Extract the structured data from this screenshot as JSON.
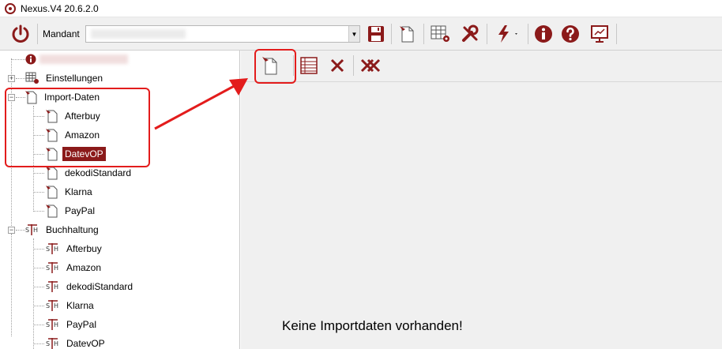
{
  "window": {
    "title": "Nexus.V4 20.6.2.0"
  },
  "toolbar": {
    "mandant_label": "Mandant",
    "icons": [
      "power-icon",
      "save-icon",
      "new-document-icon",
      "table-settings-icon",
      "tools-icon",
      "lightning-icon",
      "info-icon",
      "help-icon",
      "screen-icon"
    ]
  },
  "tree": {
    "einstellungen": "Einstellungen",
    "import_daten": "Import-Daten",
    "import_children": [
      "Afterbuy",
      "Amazon",
      "DatevOP",
      "dekodiStandard",
      "Klarna",
      "PayPal"
    ],
    "buchhaltung": "Buchhaltung",
    "buchhaltung_children": [
      "Afterbuy",
      "Amazon",
      "dekodiStandard",
      "Klarna",
      "PayPal",
      "DatevOP"
    ]
  },
  "main": {
    "tools": [
      "new-import-icon",
      "list-icon",
      "delete-icon",
      "delete-all-icon"
    ],
    "empty_message": "Keine Importdaten vorhanden!"
  },
  "colors": {
    "accent": "#8b1a1a",
    "annotation": "#e31c1c"
  }
}
